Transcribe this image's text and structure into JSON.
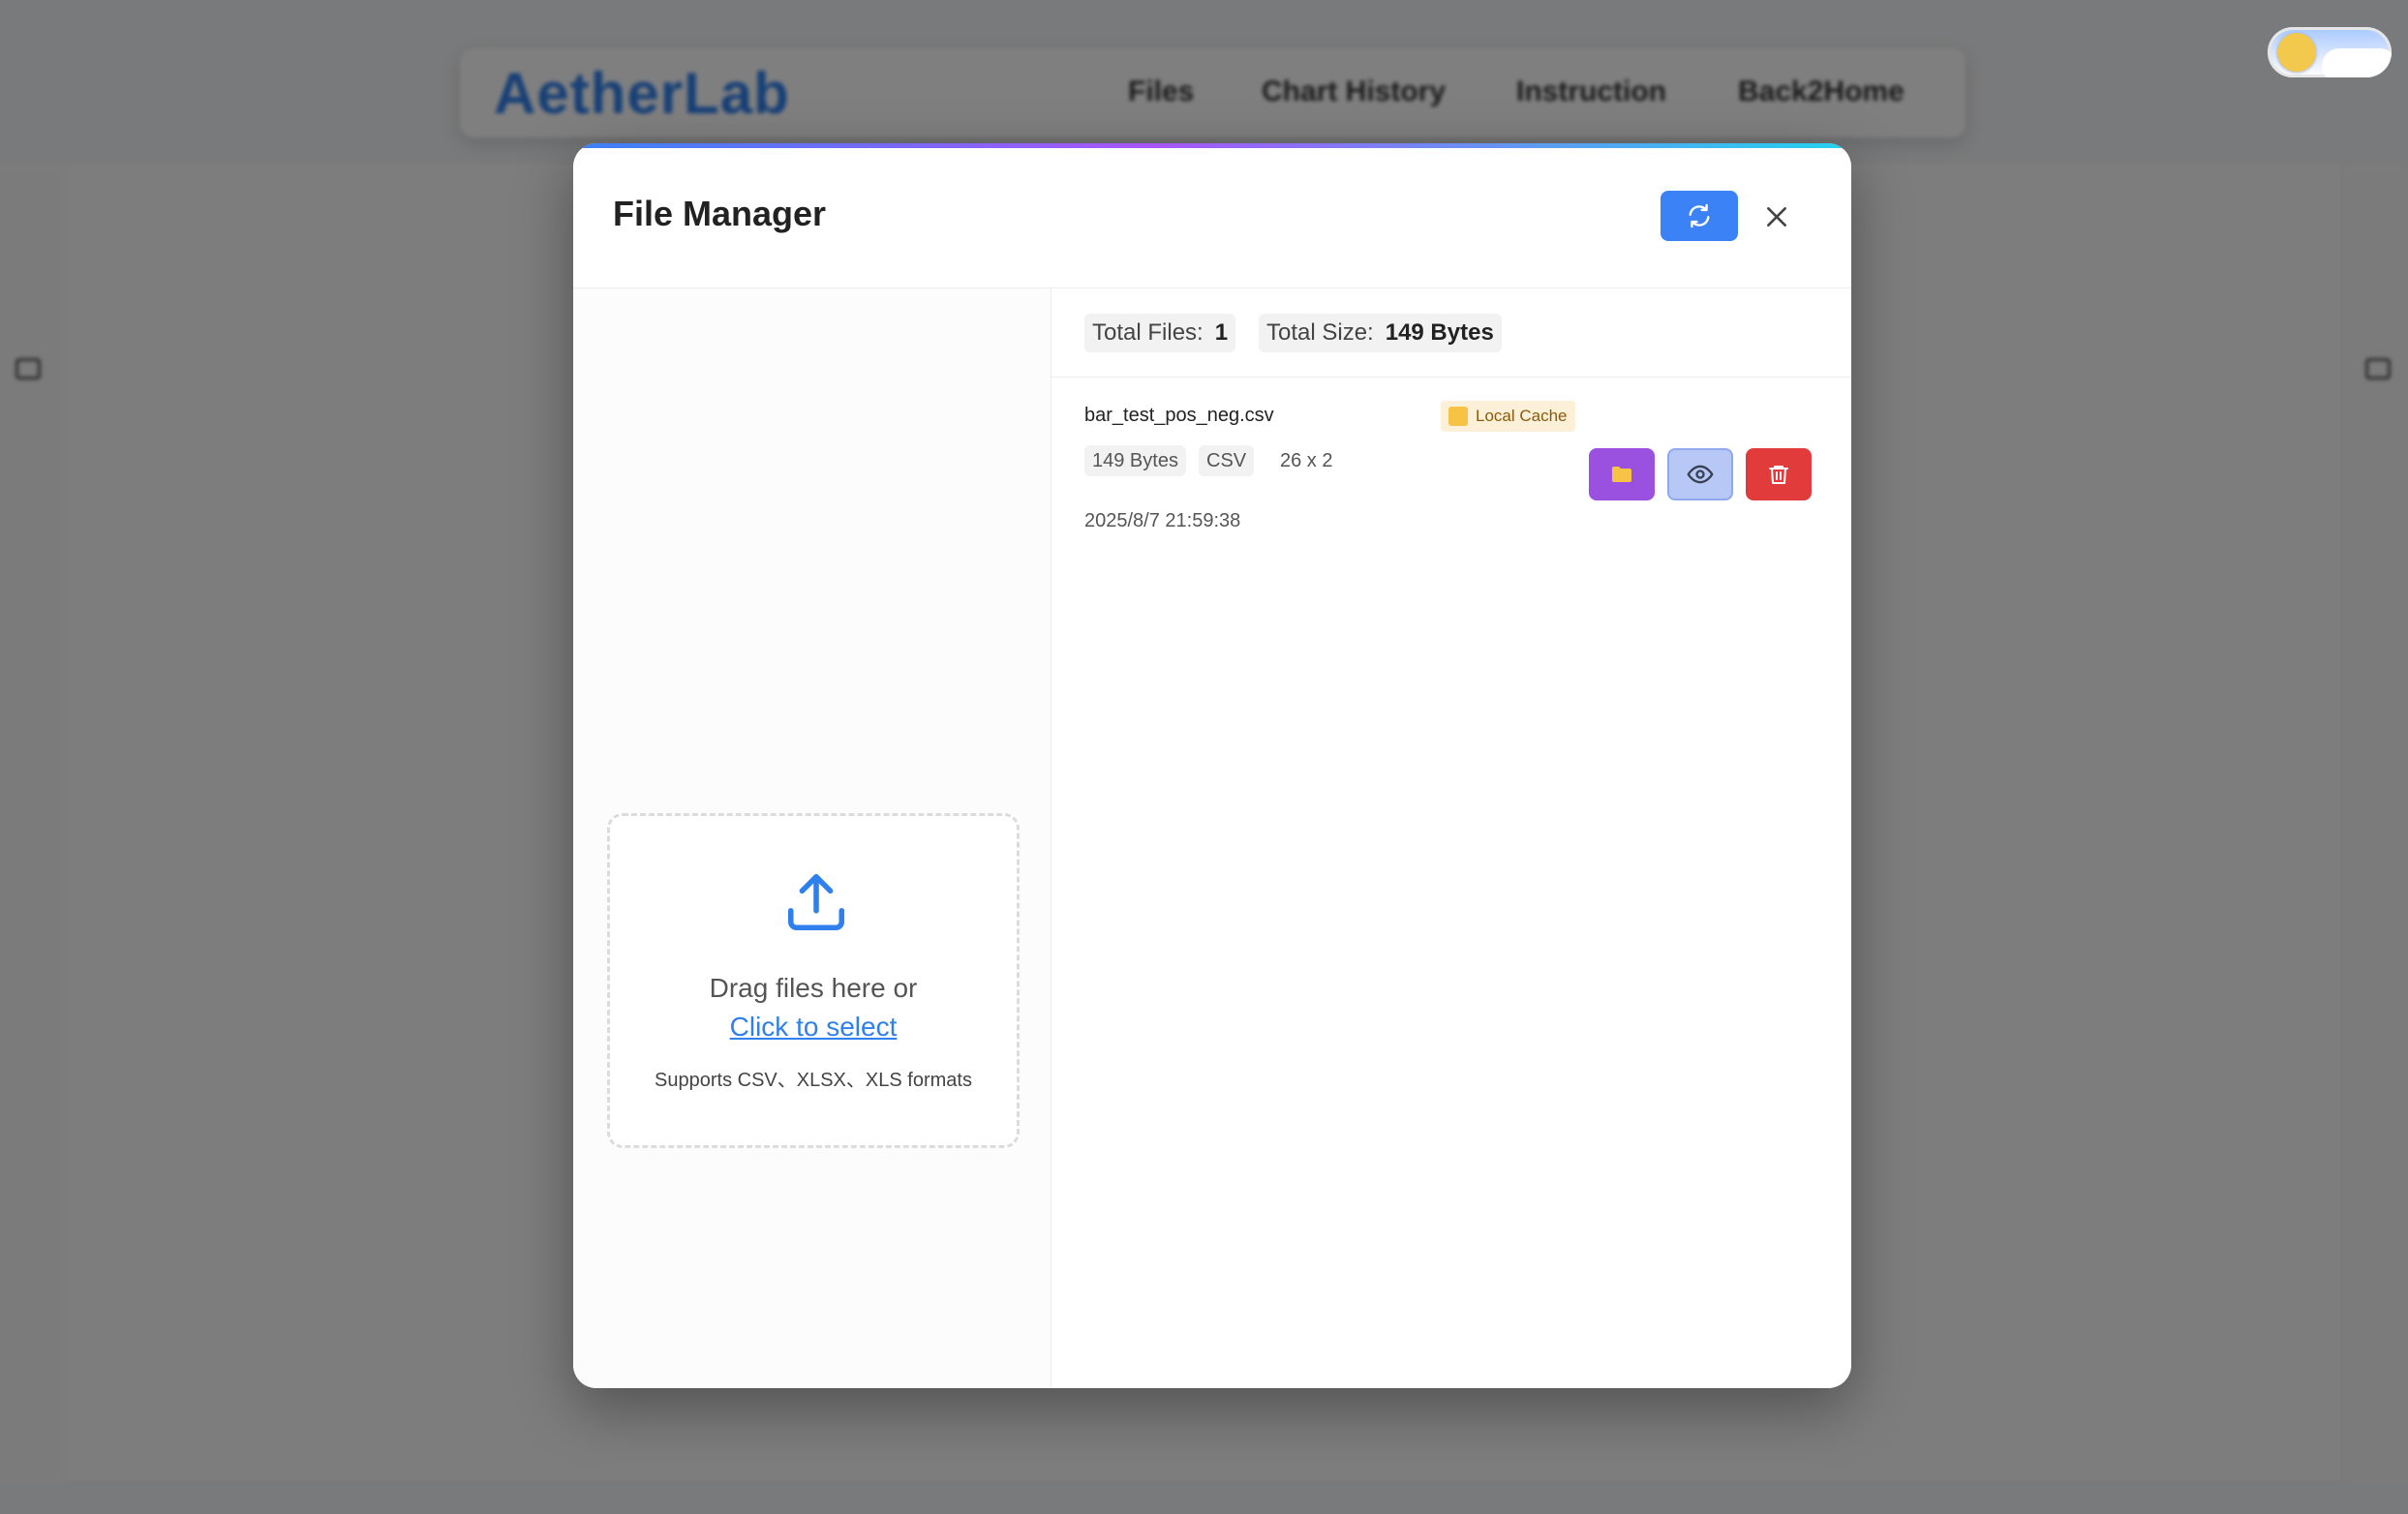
{
  "background": {
    "logo": "AetherLab",
    "nav_items": [
      "Files",
      "Chart History",
      "Instruction",
      "Back2Home"
    ]
  },
  "modal": {
    "title": "File Manager",
    "icons": {
      "refresh": "refresh-icon",
      "close": "close-icon",
      "upload": "upload-icon",
      "folder": "folder-icon",
      "view": "eye-icon",
      "delete": "trash-icon"
    },
    "upload": {
      "drag_text": "Drag files here or",
      "select_link": "Click to select",
      "formats": "Supports CSV、XLSX、XLS formats"
    },
    "stats": {
      "total_files_label": "Total Files:",
      "total_files_value": "1",
      "total_size_label": "Total Size:",
      "total_size_value": "149 Bytes"
    },
    "files": [
      {
        "name": "bar_test_pos_neg.csv",
        "badge": "Local Cache",
        "size": "149 Bytes",
        "type": "CSV",
        "dimensions": "26 x 2",
        "date": "2025/8/7 21:59:38"
      }
    ]
  },
  "colors": {
    "primary": "#3b82f6",
    "open_button": "#9b51e0",
    "view_button": "#b7c8f6",
    "delete_button": "#e23b3b",
    "badge_bg": "#fdf0d9"
  }
}
